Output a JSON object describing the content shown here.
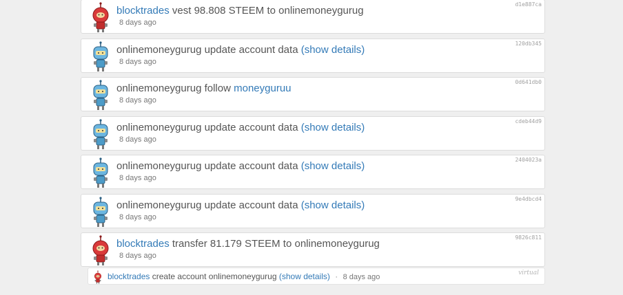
{
  "operations": [
    {
      "actor": "blocktrades",
      "avatar": "red-robot-icon",
      "text": "vest 98.808 STEEM to onlinemoneygurug",
      "link": "",
      "time": "8 days ago",
      "hash": "d1e887ca"
    },
    {
      "actor": "onlinemoneygurug",
      "avatar": "blue-robot-icon",
      "text": "update account data",
      "link": "(show details)",
      "time": "8 days ago",
      "hash": "120db345"
    },
    {
      "actor": "onlinemoneygurug",
      "avatar": "blue-robot-icon",
      "text": "follow",
      "link": "moneyguruu",
      "time": "8 days ago",
      "hash": "0d641db0"
    },
    {
      "actor": "onlinemoneygurug",
      "avatar": "blue-robot-icon",
      "text": "update account data",
      "link": "(show details)",
      "time": "8 days ago",
      "hash": "cdeb44d9"
    },
    {
      "actor": "onlinemoneygurug",
      "avatar": "blue-robot-icon",
      "text": "update account data",
      "link": "(show details)",
      "time": "8 days ago",
      "hash": "2404023a"
    },
    {
      "actor": "onlinemoneygurug",
      "avatar": "blue-robot-icon",
      "text": "update account data",
      "link": "(show details)",
      "time": "8 days ago",
      "hash": "9e4dbcd4"
    },
    {
      "actor": "blocktrades",
      "avatar": "red-robot-icon",
      "text": "transfer 81.179 STEEM to onlinemoneygurug",
      "link": "",
      "time": "8 days ago",
      "hash": "9826c811"
    }
  ],
  "virtual_op": {
    "actor": "blocktrades",
    "text": "create account onlinemoneygurug",
    "link": "(show details)",
    "separator": "·",
    "time": "8 days ago",
    "tag": "virtual"
  },
  "colors": {
    "link": "#337ab7",
    "text": "#555555",
    "background": "#efefef"
  }
}
